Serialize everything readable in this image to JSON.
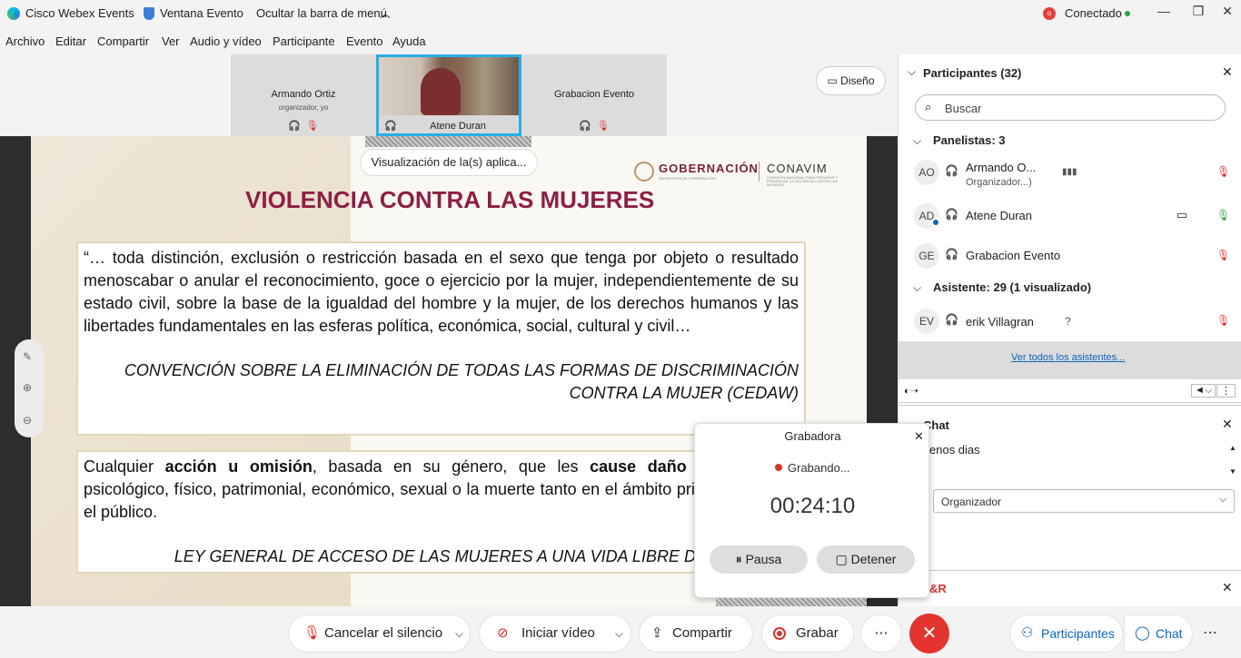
{
  "titlebar": {
    "app": "Cisco Webex Events",
    "window": "Ventana Evento",
    "hide_menu": "Ocultar la barra de menú",
    "status": "Conectado"
  },
  "menu": [
    "Archivo",
    "Editar",
    "Compartir",
    "Ver",
    "Audio y vídeo",
    "Participante",
    "Evento",
    "Ayuda"
  ],
  "tiles": [
    {
      "name": "Armando Ortiz",
      "sub": "organizador, yo"
    },
    {
      "name": "Atene Duran"
    },
    {
      "name": "Grabacion Evento"
    }
  ],
  "layout_label": "Diseño",
  "sharing_label": "Visualización de la(s) aplica...",
  "slide": {
    "brand_left": "GOBERNACIÓN",
    "brand_left_sub": "SECRETARÍA DE GOBERNACIÓN",
    "brand_right": "CONAVIM",
    "brand_right_sub": "COMISIÓN NACIONAL PARA PREVENIR Y ERRADICAR LA VIOLENCIA CONTRA LAS MUJERES",
    "title": "VIOLENCIA CONTRA LAS MUJERES",
    "quote1": "“… toda distinción, exclusión o restricción basada en el sexo que tenga por objeto o resultado menoscabar o anular el reconocimiento, goce o ejercicio por la mujer, independientemente de su estado civil, sobre la base de la igualdad del hombre y la mujer, de los derechos humanos y las libertades fundamentales en las esferas política, económica, social, cultural y civil…",
    "source1": "CONVENCIÓN SOBRE LA ELIMINACIÓN DE TODAS LAS FORMAS DE DISCRIMINACIÓN CONTRA LA MUJER (CEDAW)",
    "quote2_a": "Cualquier ",
    "quote2_b": "acción u omisión",
    "quote2_c": ", basada en su género, que les ",
    "quote2_d": "cause daño",
    "quote2_e": " o sufrimiento psicológico, físico, patrimonial, económico, sexual o la muerte tanto en el ámbito privado como en el público.",
    "source2": "LEY GENERAL DE ACCESO DE LAS MUJERES A UNA VIDA LIBRE DE VIOLENCIA"
  },
  "participants": {
    "header": "Participantes (32)",
    "search_placeholder": "Buscar",
    "panelists_label": "Panelistas: 3",
    "panelists": [
      {
        "initials": "AO",
        "name": "Armando O...",
        "role": "Organizador...)"
      },
      {
        "initials": "AD",
        "name": "Atene Duran"
      },
      {
        "initials": "GE",
        "name": "Grabacion Evento"
      }
    ],
    "attendees_label": "Asistente: 29 (1 visualizado)",
    "attendees": [
      {
        "initials": "EV",
        "name": "erik Villagran",
        "mark": "?"
      }
    ],
    "see_all": "Ver todos los asistentes..."
  },
  "chat": {
    "header": "Chat",
    "message": "enos dias",
    "to_select": "Organizador"
  },
  "qa_header": "&R",
  "recorder": {
    "title": "Grabadora",
    "state": "Grabando...",
    "time": "00:24:10",
    "pause": "Pausa",
    "stop": "Detener"
  },
  "toolbar": {
    "mute": "Cancelar el silencio",
    "video": "Iniciar vídeo",
    "share": "Compartir",
    "record": "Grabar",
    "participants": "Participantes",
    "chat": "Chat"
  },
  "colors": {
    "slide_title": "#8e1f45",
    "accent_blue": "#0c64c0",
    "end_red": "#e3342f",
    "active_border": "#29aee6",
    "record_red": "#d9342b"
  }
}
